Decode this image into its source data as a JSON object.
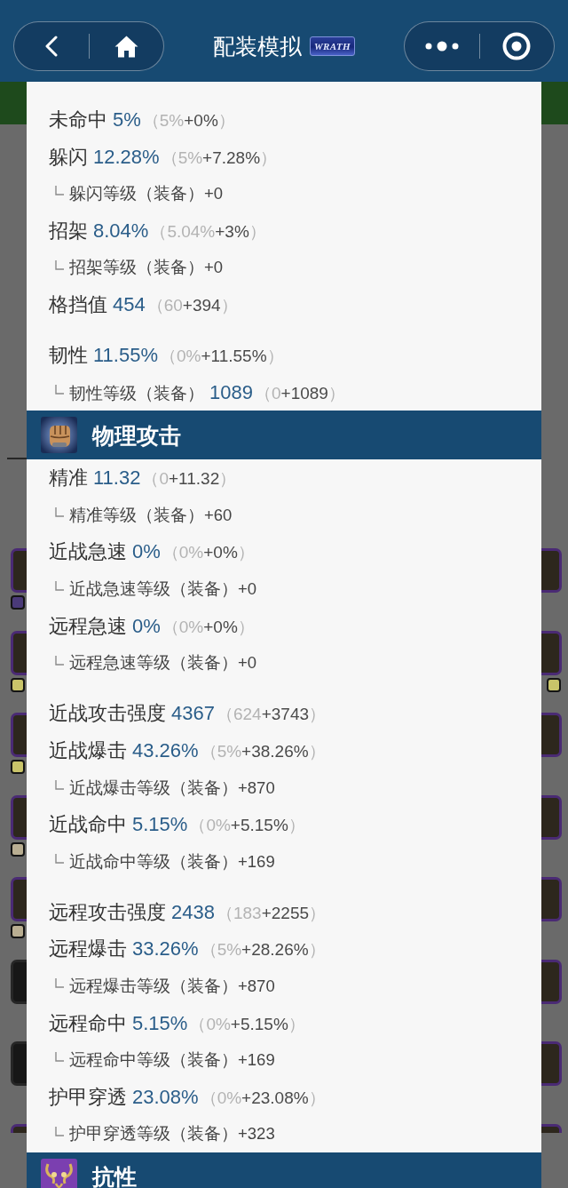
{
  "nav": {
    "title": "配装模拟",
    "logo_text": "WRATH"
  },
  "background": {
    "left_slots": [
      {
        "epic": true,
        "cut": false,
        "gems": [
          {
            "color": "#4a3a78"
          }
        ]
      },
      {
        "epic": true,
        "cut": false,
        "gems": [
          {
            "color": "#c9c46a"
          }
        ]
      },
      {
        "epic": true,
        "cut": false,
        "gems": [
          {
            "color": "#c9c46a"
          }
        ]
      },
      {
        "epic": true,
        "cut": false,
        "gems": [
          {
            "color": "#b9ae92"
          }
        ]
      },
      {
        "epic": true,
        "cut": false,
        "gems": [
          {
            "color": "#b9ae92"
          }
        ]
      },
      {
        "epic": false,
        "cut": false
      },
      {
        "epic": false,
        "cut": false
      },
      {
        "epic": true,
        "cut": true
      }
    ],
    "right_slots": [
      {
        "epic": true,
        "cut": false
      },
      {
        "epic": true,
        "cut": false,
        "gems": [
          {
            "color": "#c9c46a"
          }
        ]
      },
      {
        "epic": true,
        "cut": false
      },
      {
        "epic": true,
        "cut": false
      },
      {
        "epic": true,
        "cut": false
      },
      {
        "epic": true,
        "cut": false
      },
      {
        "epic": true,
        "cut": false
      },
      {
        "epic": true,
        "cut": true
      }
    ]
  },
  "stats_panel": {
    "sections": [
      {
        "groups": [
          {
            "rows": [
              {
                "kind": "stat",
                "label": "未命中",
                "value": "5%",
                "breakdown": {
                  "open": "（",
                  "base": "5%",
                  "bonus": "+0%",
                  "close": "）"
                }
              },
              {
                "kind": "stat",
                "label": "躲闪",
                "value": "12.28%",
                "breakdown": {
                  "open": "（",
                  "base": "5%",
                  "bonus": "+7.28%",
                  "close": "）"
                }
              },
              {
                "kind": "sub",
                "label": "躲闪等级（装备）+0"
              },
              {
                "kind": "stat",
                "label": "招架",
                "value": "8.04%",
                "breakdown": {
                  "open": "（",
                  "base": "5.04%",
                  "bonus": "+3%",
                  "close": "）"
                }
              },
              {
                "kind": "sub",
                "label": "招架等级（装备）+0"
              },
              {
                "kind": "stat",
                "label": "格挡值",
                "value": "454",
                "breakdown": {
                  "open": "（",
                  "base": "60",
                  "bonus": "+394",
                  "close": "）"
                }
              }
            ]
          },
          {
            "rows": [
              {
                "kind": "stat",
                "label": "韧性",
                "value": "11.55%",
                "breakdown": {
                  "open": "（",
                  "base": "0%",
                  "bonus": "+11.55%",
                  "close": "）"
                }
              },
              {
                "kind": "sub",
                "label": "韧性等级（装备）",
                "value": "1089",
                "breakdown": {
                  "open": "（",
                  "base": "0",
                  "bonus": "+1089",
                  "close": "）"
                }
              }
            ]
          }
        ]
      },
      {
        "title": "物理攻击",
        "kind": "attack",
        "groups": [
          {
            "rows": [
              {
                "kind": "stat",
                "label": "精准",
                "value": "11.32",
                "breakdown": {
                  "open": "（",
                  "base": "0",
                  "bonus": "+11.32",
                  "close": "）"
                }
              },
              {
                "kind": "sub",
                "label": "精准等级（装备）+60"
              },
              {
                "kind": "stat",
                "label": "近战急速",
                "value": "0%",
                "breakdown": {
                  "open": "（",
                  "base": "0%",
                  "bonus": "+0%",
                  "close": "）"
                }
              },
              {
                "kind": "sub",
                "label": "近战急速等级（装备）+0"
              },
              {
                "kind": "stat",
                "label": "远程急速",
                "value": "0%",
                "breakdown": {
                  "open": "（",
                  "base": "0%",
                  "bonus": "+0%",
                  "close": "）"
                }
              },
              {
                "kind": "sub",
                "label": "远程急速等级（装备）+0"
              }
            ]
          },
          {
            "rows": [
              {
                "kind": "stat",
                "label": "近战攻击强度",
                "value": "4367",
                "breakdown": {
                  "open": "（",
                  "base": "624",
                  "bonus": "+3743",
                  "close": "）"
                }
              },
              {
                "kind": "stat",
                "label": "近战爆击",
                "value": "43.26%",
                "breakdown": {
                  "open": "（",
                  "base": "5%",
                  "bonus": "+38.26%",
                  "close": "）"
                }
              },
              {
                "kind": "sub",
                "label": "近战爆击等级（装备）+870"
              },
              {
                "kind": "stat",
                "label": "近战命中",
                "value": "5.15%",
                "breakdown": {
                  "open": "（",
                  "base": "0%",
                  "bonus": "+5.15%",
                  "close": "）"
                }
              },
              {
                "kind": "sub",
                "label": "近战命中等级（装备）+169"
              }
            ]
          },
          {
            "rows": [
              {
                "kind": "stat",
                "label": "远程攻击强度",
                "value": "2438",
                "breakdown": {
                  "open": "（",
                  "base": "183",
                  "bonus": "+2255",
                  "close": "）"
                }
              },
              {
                "kind": "stat",
                "label": "远程爆击",
                "value": "33.26%",
                "breakdown": {
                  "open": "（",
                  "base": "5%",
                  "bonus": "+28.26%",
                  "close": "）"
                }
              },
              {
                "kind": "sub",
                "label": "远程爆击等级（装备）+870"
              },
              {
                "kind": "stat",
                "label": "远程命中",
                "value": "5.15%",
                "breakdown": {
                  "open": "（",
                  "base": "0%",
                  "bonus": "+5.15%",
                  "close": "）"
                }
              },
              {
                "kind": "sub",
                "label": "远程命中等级（装备）+169"
              },
              {
                "kind": "stat",
                "label": "护甲穿透",
                "value": "23.08%",
                "breakdown": {
                  "open": "（",
                  "base": "0%",
                  "bonus": "+23.08%",
                  "close": "）"
                }
              },
              {
                "kind": "sub",
                "label": "护甲穿透等级（装备）+323"
              }
            ]
          }
        ]
      },
      {
        "title": "抗性",
        "kind": "resistance"
      }
    ]
  }
}
